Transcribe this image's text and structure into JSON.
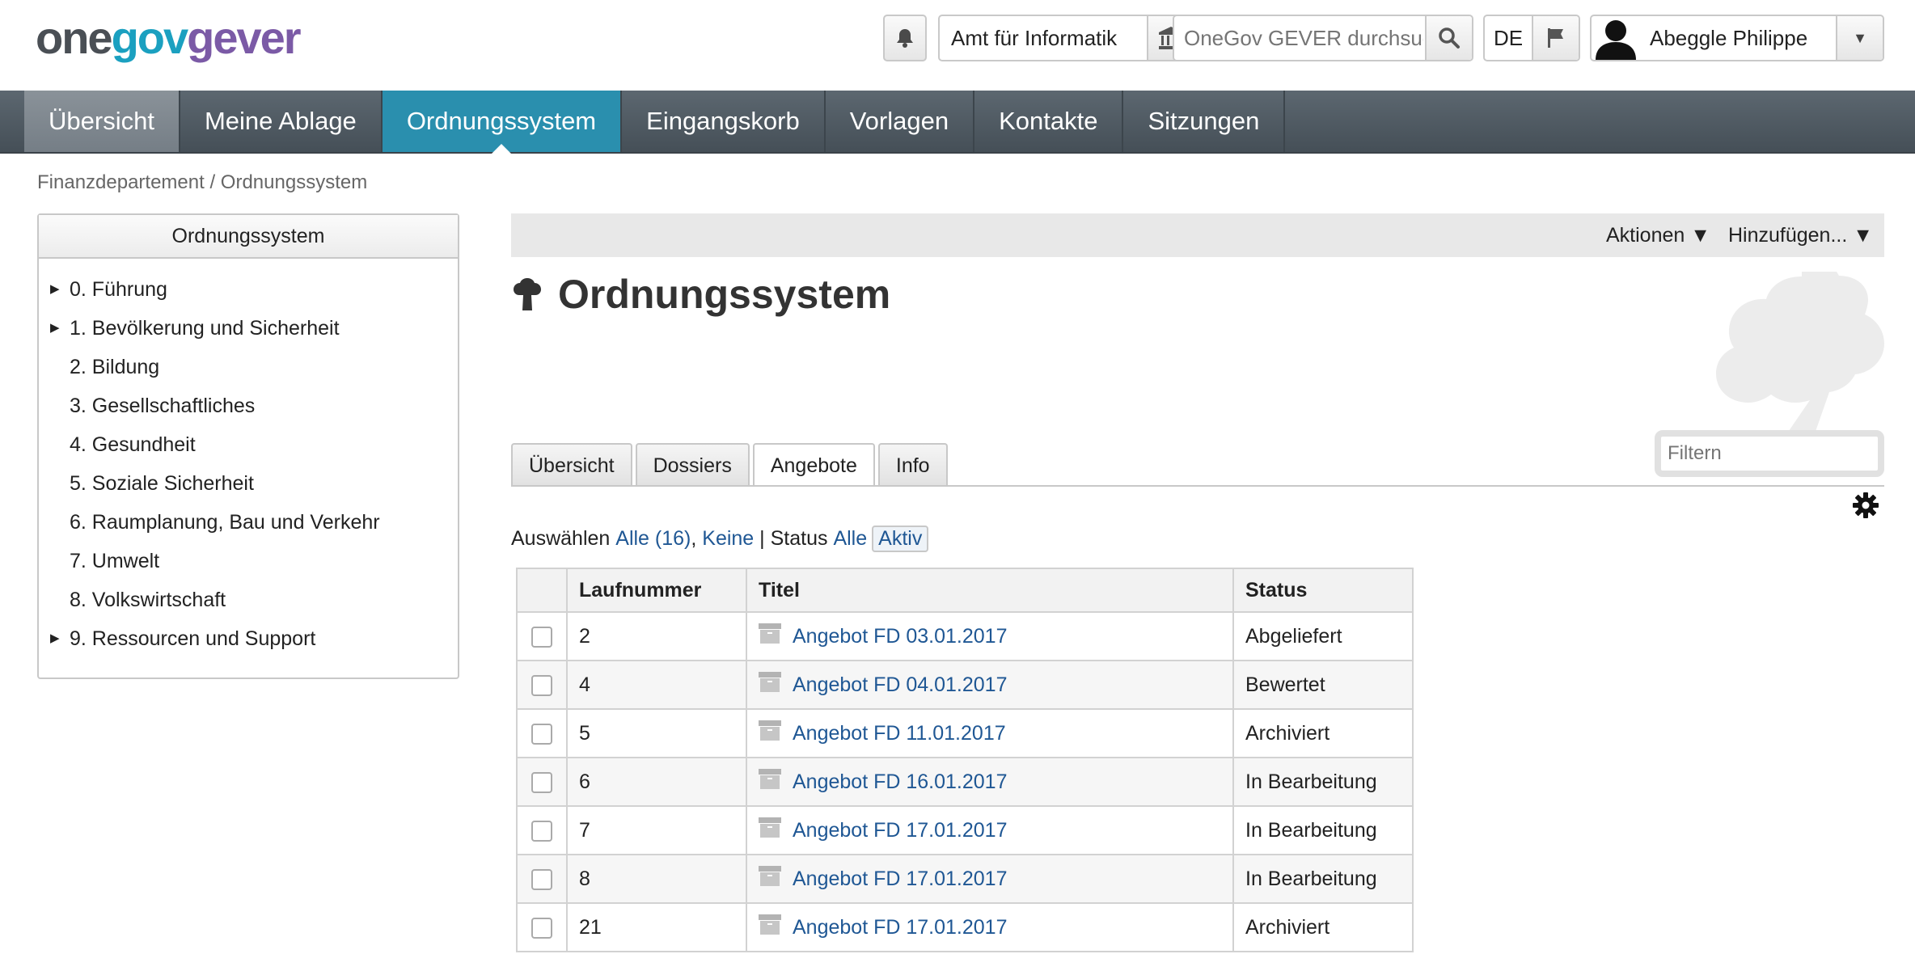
{
  "logo": {
    "part1": "one",
    "part2": "gov",
    "part3": "gever"
  },
  "header": {
    "org_unit": "Amt für Informatik",
    "search_placeholder": "OneGov GEVER durchsuchen",
    "language": "DE",
    "user_name": "Abeggle Philippe"
  },
  "nav": {
    "items": [
      "Übersicht",
      "Meine Ablage",
      "Ordnungssystem",
      "Eingangskorb",
      "Vorlagen",
      "Kontakte",
      "Sitzungen"
    ],
    "active": "Ordnungssystem"
  },
  "breadcrumb": "Finanzdepartement / Ordnungssystem",
  "sidebar": {
    "title": "Ordnungssystem",
    "items": [
      {
        "label": "0. Führung",
        "expandable": true
      },
      {
        "label": "1. Bevölkerung und Sicherheit",
        "expandable": true
      },
      {
        "label": "2. Bildung",
        "expandable": false
      },
      {
        "label": "3. Gesellschaftliches",
        "expandable": false
      },
      {
        "label": "4. Gesundheit",
        "expandable": false
      },
      {
        "label": "5. Soziale Sicherheit",
        "expandable": false
      },
      {
        "label": "6. Raumplanung, Bau und Verkehr",
        "expandable": false
      },
      {
        "label": "7. Umwelt",
        "expandable": false
      },
      {
        "label": "8. Volkswirtschaft",
        "expandable": false
      },
      {
        "label": "9. Ressourcen und Support",
        "expandable": true
      }
    ]
  },
  "actionbar": {
    "actions": "Aktionen ▼",
    "add": "Hinzufügen... ▼"
  },
  "page": {
    "title": "Ordnungssystem"
  },
  "tabs": {
    "items": [
      "Übersicht",
      "Dossiers",
      "Angebote",
      "Info"
    ],
    "active": "Angebote"
  },
  "filter": {
    "placeholder": "Filtern"
  },
  "selection": {
    "prefix": "Auswählen",
    "all": "Alle (16)",
    "comma": ",",
    "none": "Keine",
    "separator": "|",
    "status_label": "Status",
    "status_all": "Alle",
    "status_active": "Aktiv"
  },
  "table": {
    "columns": [
      "Laufnummer",
      "Titel",
      "Status"
    ],
    "rows": [
      {
        "number": "2",
        "title": "Angebot FD 03.01.2017",
        "status": "Abgeliefert"
      },
      {
        "number": "4",
        "title": "Angebot FD 04.01.2017",
        "status": "Bewertet"
      },
      {
        "number": "5",
        "title": "Angebot FD 11.01.2017",
        "status": "Archiviert"
      },
      {
        "number": "6",
        "title": "Angebot FD 16.01.2017",
        "status": "In Bearbeitung"
      },
      {
        "number": "7",
        "title": "Angebot FD 17.01.2017",
        "status": "In Bearbeitung"
      },
      {
        "number": "8",
        "title": "Angebot FD 17.01.2017",
        "status": "In Bearbeitung"
      },
      {
        "number": "21",
        "title": "Angebot FD 17.01.2017",
        "status": "Archiviert"
      }
    ]
  },
  "icons": {
    "notifications": "bell-icon",
    "org": "bank-icon",
    "search": "search-icon",
    "language": "flag-icon",
    "user": "avatar-icon",
    "user_menu": "chevron-down-icon",
    "title": "tree-icon",
    "settings": "gear-icon",
    "row": "archive-box-icon"
  },
  "colors": {
    "nav_active": "#2a8fae",
    "nav_bg": "#4f5962",
    "link": "#1f5794"
  }
}
